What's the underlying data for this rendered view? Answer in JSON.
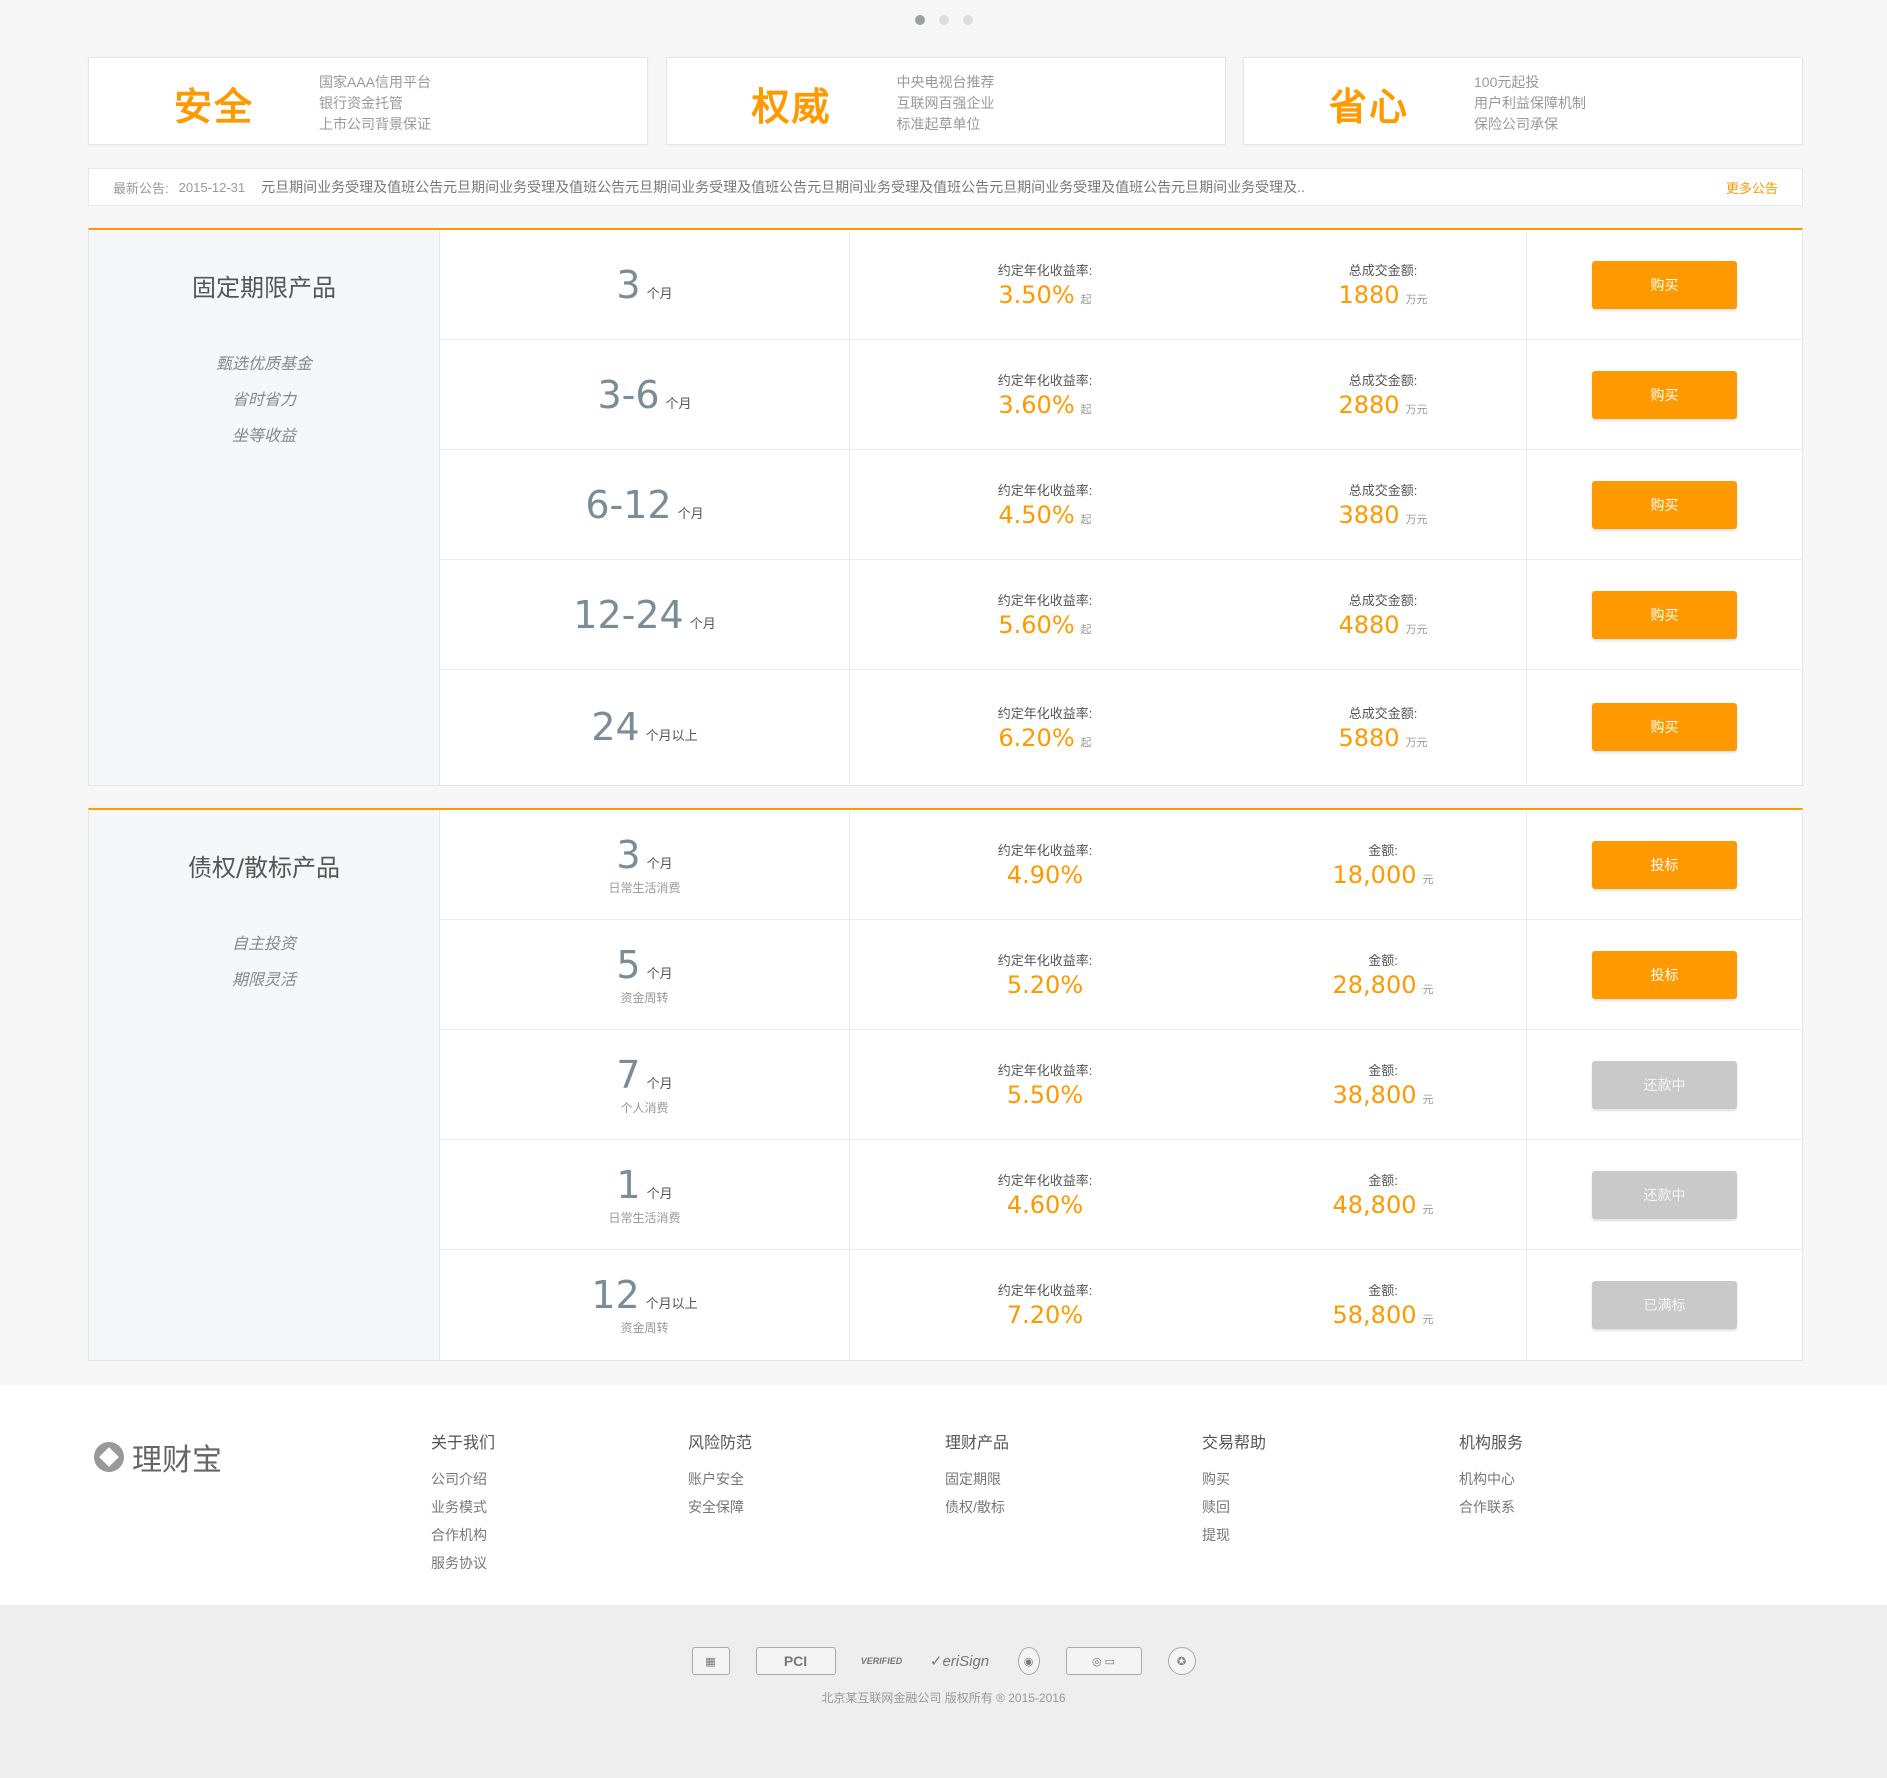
{
  "carousel": {
    "dots": 3,
    "active": 0
  },
  "features": [
    {
      "title": "安全",
      "lines": [
        "国家AAA信用平台",
        "银行资金托管",
        "上市公司背景保证"
      ]
    },
    {
      "title": "权威",
      "lines": [
        "中央电视台推荐",
        "互联网百强企业",
        "标准起草单位"
      ]
    },
    {
      "title": "省心",
      "lines": [
        "100元起投",
        "用户利益保障机制",
        "保险公司承保"
      ]
    }
  ],
  "notice": {
    "label": "最新公告:",
    "date": "2015-12-31",
    "text": "元旦期间业务受理及值班公告元旦期间业务受理及值班公告元旦期间业务受理及值班公告元旦期间业务受理及值班公告元旦期间业务受理及值班公告元旦期间业务受理及..",
    "more": "更多公告"
  },
  "fixed": {
    "title": "固定期限产品",
    "features": [
      "甄选优质基金",
      "省时省力",
      "坐等收益"
    ],
    "rate_label": "约定年化收益率:",
    "amount_label": "总成交金额:",
    "rate_suffix": "起",
    "amount_unit": "万元",
    "rows": [
      {
        "term": "3",
        "unit": "个月",
        "rate": "3.50%",
        "amount": "1880",
        "button": "购买"
      },
      {
        "term": "3-6",
        "unit": "个月",
        "rate": "3.60%",
        "amount": "2880",
        "button": "购买"
      },
      {
        "term": "6-12",
        "unit": "个月",
        "rate": "4.50%",
        "amount": "3880",
        "button": "购买"
      },
      {
        "term": "12-24",
        "unit": "个月",
        "rate": "5.60%",
        "amount": "4880",
        "button": "购买"
      },
      {
        "term": "24",
        "unit": "个月以上",
        "rate": "6.20%",
        "amount": "5880",
        "button": "购买"
      }
    ]
  },
  "debt": {
    "title": "债权/散标产品",
    "features": [
      "自主投资",
      "期限灵活"
    ],
    "rate_label": "约定年化收益率:",
    "amount_label": "金额:",
    "amount_unit": "元",
    "rows": [
      {
        "term": "3",
        "unit": "个月",
        "sub": "日常生活消费",
        "rate": "4.90%",
        "amount": "18,000",
        "button": "投标",
        "state": "active"
      },
      {
        "term": "5",
        "unit": "个月",
        "sub": "资金周转",
        "rate": "5.20%",
        "amount": "28,800",
        "button": "投标",
        "state": "active"
      },
      {
        "term": "7",
        "unit": "个月",
        "sub": "个人消费",
        "rate": "5.50%",
        "amount": "38,800",
        "button": "还款中",
        "state": "disabled"
      },
      {
        "term": "1",
        "unit": "个月",
        "sub": "日常生活消费",
        "rate": "4.60%",
        "amount": "48,800",
        "button": "还款中",
        "state": "disabled"
      },
      {
        "term": "12",
        "unit": "个月以上",
        "sub": "资金周转",
        "rate": "7.20%",
        "amount": "58,800",
        "button": "已满标",
        "state": "disabled"
      }
    ]
  },
  "footer": {
    "logo": "理财宝",
    "columns": [
      {
        "title": "关于我们",
        "links": [
          "公司介绍",
          "业务模式",
          "合作机构",
          "服务协议"
        ]
      },
      {
        "title": "风险防范",
        "links": [
          "账户安全",
          "安全保障"
        ]
      },
      {
        "title": "理财产品",
        "links": [
          "固定期限",
          "债权/散标"
        ]
      },
      {
        "title": "交易帮助",
        "links": [
          "购买",
          "赎回",
          "提现"
        ]
      },
      {
        "title": "机构服务",
        "links": [
          "机构中心",
          "合作联系"
        ]
      }
    ],
    "badges": [
      "shield-badge",
      "PCI",
      "VERIFIED by VISA",
      "VeriSign",
      "lock-badge",
      "trust-badge",
      "police-badge"
    ],
    "copyright": "北京某互联网金融公司 版权所有 ® 2015-2016"
  },
  "colors": {
    "accent": "#ff9900",
    "disabled": "#c9c9c9",
    "term": "#7a8c96"
  }
}
